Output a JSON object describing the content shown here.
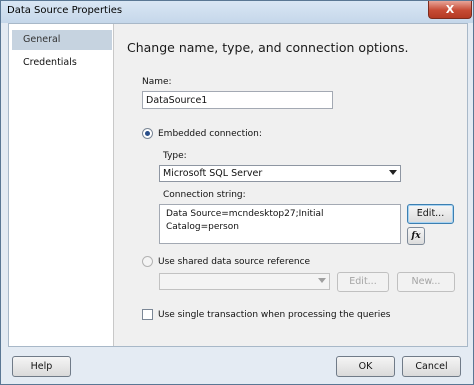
{
  "window": {
    "title": "Data Source Properties",
    "close_glyph": "X"
  },
  "nav": {
    "items": [
      {
        "label": "General"
      },
      {
        "label": "Credentials"
      }
    ]
  },
  "main": {
    "heading": "Change name, type, and connection options.",
    "name_label": "Name:",
    "name_value": "DataSource1",
    "embedded_label": "Embedded connection:",
    "type_label": "Type:",
    "type_value": "Microsoft SQL Server",
    "conn_label": "Connection string:",
    "conn_value": "Data Source=mcndesktop27;Initial Catalog=person",
    "edit_label": "Edit...",
    "fx_label": "fx",
    "shared_label": "Use shared data source reference",
    "shared_value": "",
    "shared_edit_label": "Edit...",
    "shared_new_label": "New...",
    "single_tx_label": "Use single transaction when processing the queries"
  },
  "footer": {
    "help_label": "Help",
    "ok_label": "OK",
    "cancel_label": "Cancel"
  }
}
